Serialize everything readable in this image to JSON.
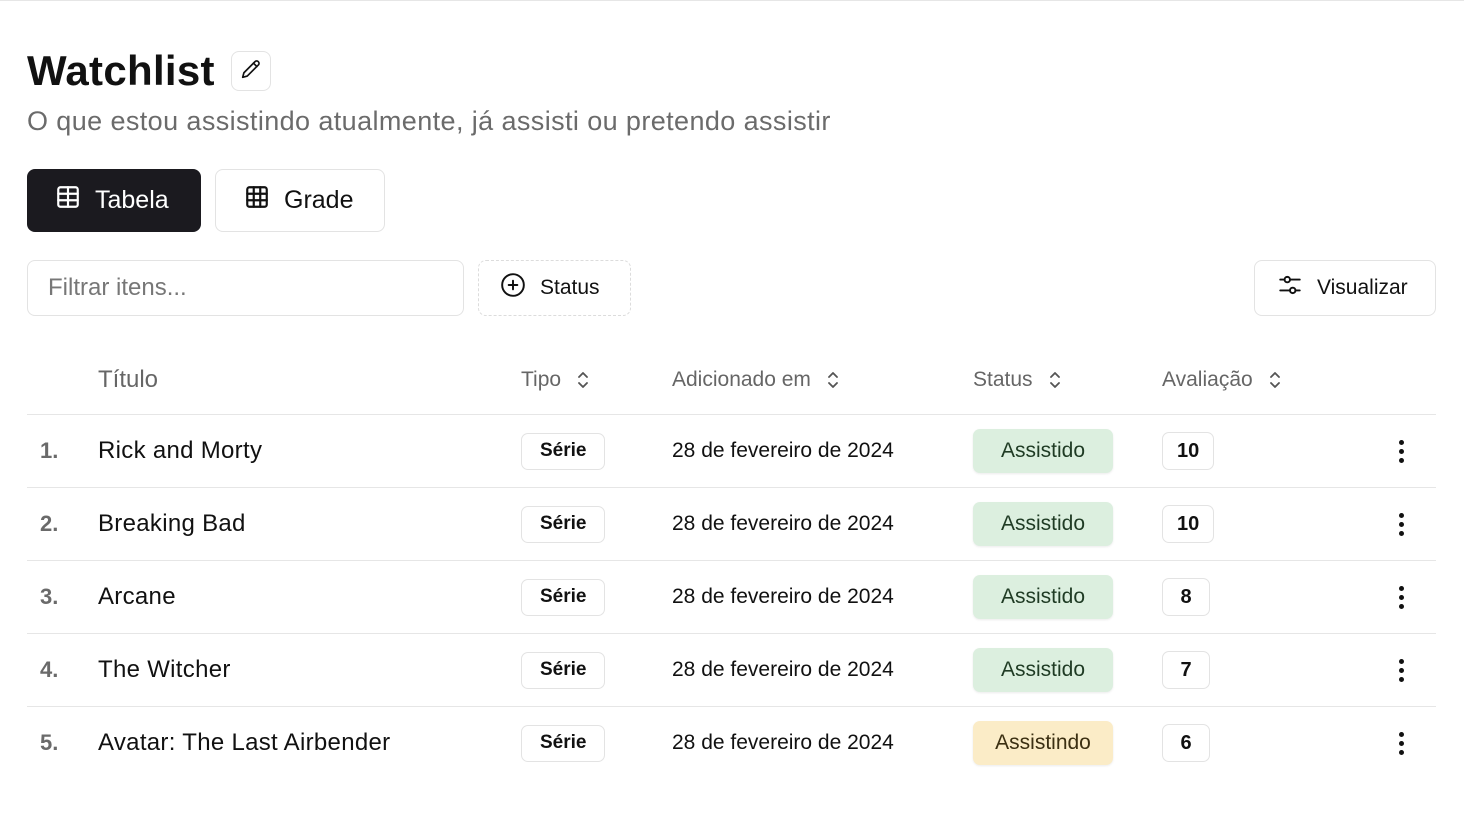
{
  "header": {
    "title": "Watchlist",
    "subtitle": "O que estou assistindo atualmente, já assisti ou pretendo assistir"
  },
  "view_toggle": {
    "table_label": "Tabela",
    "grid_label": "Grade",
    "active": "Tabela"
  },
  "toolbar": {
    "filter_placeholder": "Filtrar itens...",
    "filter_value": "",
    "status_label": "Status",
    "view_label": "Visualizar"
  },
  "table": {
    "columns": {
      "title": "Título",
      "type": "Tipo",
      "added": "Adicionado em",
      "status": "Status",
      "rating": "Avaliação"
    },
    "rows": [
      {
        "num": "1.",
        "title": "Rick and Morty",
        "type": "Série",
        "added": "28 de fevereiro de 2024",
        "status": "Assistido",
        "rating": "10"
      },
      {
        "num": "2.",
        "title": "Breaking Bad",
        "type": "Série",
        "added": "28 de fevereiro de 2024",
        "status": "Assistido",
        "rating": "10"
      },
      {
        "num": "3.",
        "title": "Arcane",
        "type": "Série",
        "added": "28 de fevereiro de 2024",
        "status": "Assistido",
        "rating": "8"
      },
      {
        "num": "4.",
        "title": "The Witcher",
        "type": "Série",
        "added": "28 de fevereiro de 2024",
        "status": "Assistido",
        "rating": "7"
      },
      {
        "num": "5.",
        "title": "Avatar: The Last Airbender",
        "type": "Série",
        "added": "28 de fevereiro de 2024",
        "status": "Assistindo",
        "rating": "6"
      }
    ]
  },
  "status_colors": {
    "Assistido": {
      "bg": "#dcefdf",
      "fg": "#1f3b24"
    },
    "Assistindo": {
      "bg": "#fbecc7",
      "fg": "#3b2f12"
    }
  },
  "icons": {
    "edit": "pencil-icon",
    "table": "table-icon",
    "grid": "grid-icon",
    "add_status": "plus-circle-icon",
    "view": "sliders-icon",
    "sort": "chevron-up-down-icon",
    "row_menu": "more-vertical-icon"
  }
}
